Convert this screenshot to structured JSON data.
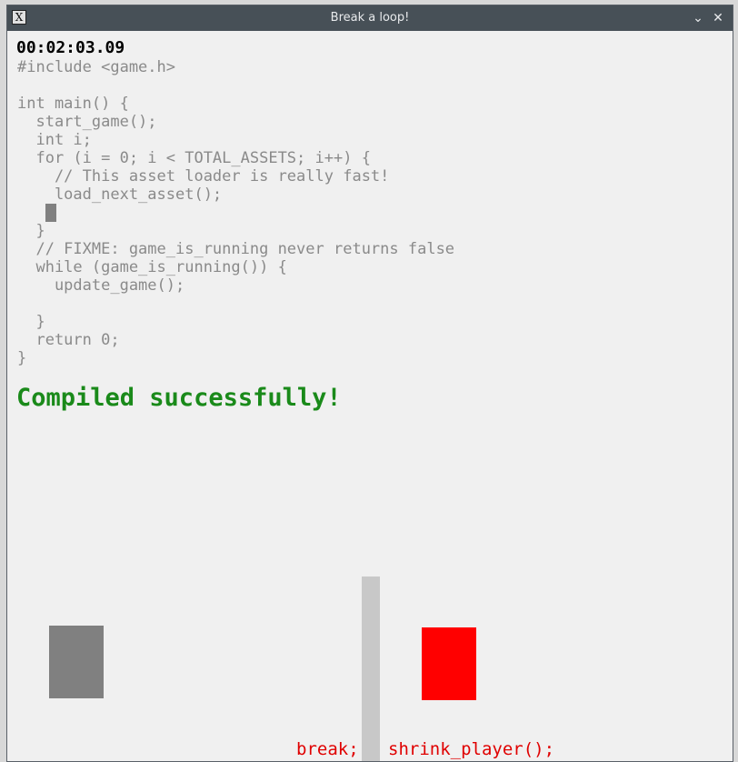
{
  "window": {
    "title": "Break a loop!",
    "icon": "x-app-icon",
    "minimize_glyph": "⌄",
    "close_glyph": "✕"
  },
  "game": {
    "timer": "00:02:03.09",
    "code_lines": [
      "#include <game.h>",
      "",
      "int main() {",
      "  start_game();",
      "  int i;",
      "  for (i = 0; i < TOTAL_ASSETS; i++) {",
      "    // This asset loader is really fast!",
      "    load_next_asset();",
      "    ",
      "  }",
      "  // FIXME: game_is_running never returns false",
      "  while (game_is_running()) {",
      "    update_game();",
      "",
      "  }",
      "  return 0;",
      "}"
    ],
    "status": "Compiled successfully!",
    "commands": {
      "break": "break;",
      "shrink": "shrink_player();"
    }
  },
  "colors": {
    "status": "#1a8a1a",
    "command": "#e00000",
    "player": "#808080",
    "enemy": "#ff0000",
    "wall": "#c8c8c8",
    "code": "#8a8a8a"
  }
}
